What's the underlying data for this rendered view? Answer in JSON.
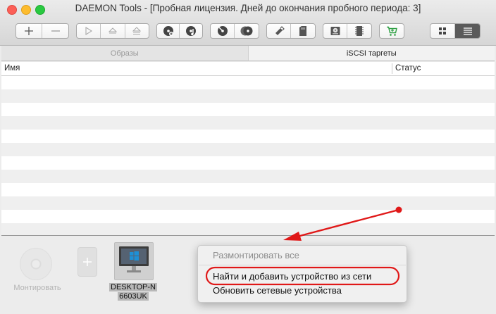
{
  "window": {
    "title": "DAEMON Tools - [Пробная лицензия. Дней до окончания пробного периода: 3]"
  },
  "toolbar": {
    "icons": [
      "add-icon",
      "remove-icon",
      "play-icon",
      "eject-icon",
      "eject-all-icon",
      "disc-create-icon",
      "disc-music-icon",
      "disc-burn-icon",
      "disc-copy-icon",
      "usb-stick-icon",
      "sd-card-icon",
      "virtual-drive-icon",
      "chip-icon",
      "cart-icon",
      "grid-view-icon",
      "list-view-icon"
    ]
  },
  "tabs": [
    {
      "label": "Образы",
      "active": false
    },
    {
      "label": "iSCSI таргеты",
      "active": true
    }
  ],
  "table": {
    "columns": [
      "Имя",
      "Статус"
    ],
    "rows": []
  },
  "bottom": {
    "mount_label": "Монтировать",
    "device_label_line1": "DESKTOP-N",
    "device_label_line2": "6603UK"
  },
  "context_menu": {
    "items": [
      {
        "label": "Размонтировать все",
        "enabled": false
      },
      {
        "label": "Найти и добавить устройство из сети",
        "enabled": true,
        "highlighted": true
      },
      {
        "label": "Обновить сетевые устройства",
        "enabled": true
      }
    ]
  },
  "colors": {
    "annotation_red": "#e01818",
    "windows_blue": "#1e90d6"
  }
}
